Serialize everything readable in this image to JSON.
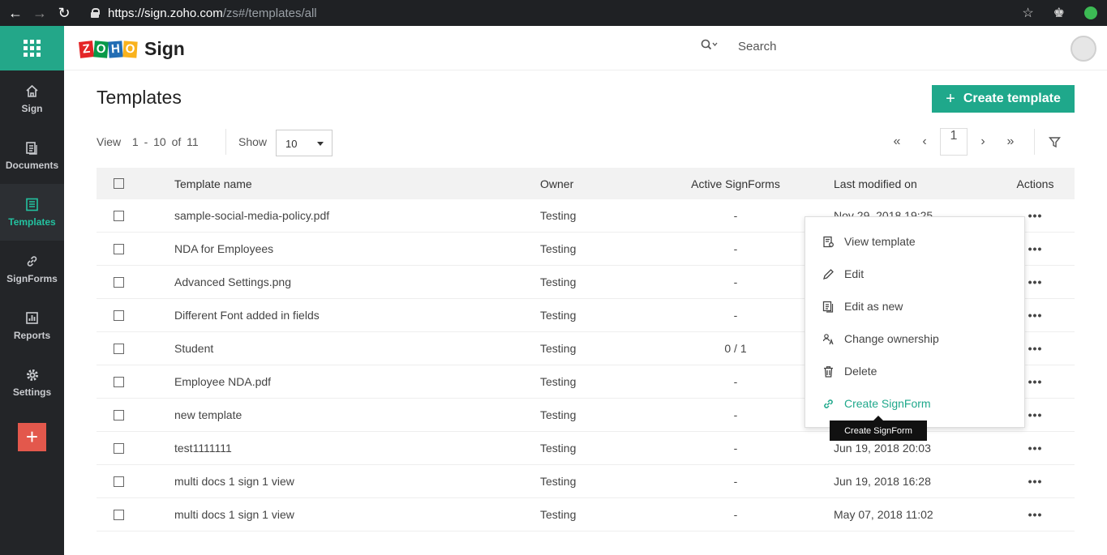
{
  "browser": {
    "url_host": "https://sign.zoho.com",
    "url_path": "/zs#/templates/all"
  },
  "brand": {
    "logo_letters": [
      "Z",
      "O",
      "H",
      "O"
    ],
    "logo_colors": [
      "#e42527",
      "#089949",
      "#226db4",
      "#f9b21d"
    ],
    "product": "Sign"
  },
  "search": {
    "placeholder": "Search"
  },
  "sidebar": {
    "items": [
      {
        "label": "Sign",
        "icon": "home-icon"
      },
      {
        "label": "Documents",
        "icon": "documents-icon"
      },
      {
        "label": "Templates",
        "icon": "templates-icon"
      },
      {
        "label": "SignForms",
        "icon": "link-icon"
      },
      {
        "label": "Reports",
        "icon": "reports-icon"
      },
      {
        "label": "Settings",
        "icon": "gear-icon"
      }
    ],
    "active": "Templates",
    "add_label": "+"
  },
  "page": {
    "title": "Templates",
    "create_label": "Create template",
    "view_label": "View",
    "range_start": "1",
    "range_sep": "-",
    "range_end": "10",
    "of_label": "of",
    "total": "11",
    "show_label": "Show",
    "show_value": "10",
    "page_number": "1"
  },
  "table": {
    "headers": [
      "Template name",
      "Owner",
      "Active SignForms",
      "Last modified on",
      "Actions"
    ],
    "rows": [
      {
        "name": "sample-social-media-policy.pdf",
        "owner": "Testing",
        "active": "-",
        "modified": "Nov 29, 2018 19:25"
      },
      {
        "name": "NDA for Employees",
        "owner": "Testing",
        "active": "-",
        "modified": ""
      },
      {
        "name": "Advanced Settings.png",
        "owner": "Testing",
        "active": "-",
        "modified": ""
      },
      {
        "name": "Different Font added in fields",
        "owner": "Testing",
        "active": "-",
        "modified": ""
      },
      {
        "name": "Student",
        "owner": "Testing",
        "active": "0 / 1",
        "modified": ""
      },
      {
        "name": "Employee NDA.pdf",
        "owner": "Testing",
        "active": "-",
        "modified": ""
      },
      {
        "name": "new template",
        "owner": "Testing",
        "active": "-",
        "modified": ""
      },
      {
        "name": "test1111111",
        "owner": "Testing",
        "active": "-",
        "modified": "Jun 19, 2018 20:03"
      },
      {
        "name": "multi docs 1 sign 1 view",
        "owner": "Testing",
        "active": "-",
        "modified": "Jun 19, 2018 16:28"
      },
      {
        "name": "multi docs 1 sign 1 view",
        "owner": "Testing",
        "active": "-",
        "modified": "May 07, 2018 11:02"
      }
    ],
    "actions_glyph": "•••"
  },
  "menu": {
    "items": [
      {
        "label": "View template",
        "icon": "view-template-icon"
      },
      {
        "label": "Edit",
        "icon": "pencil-icon"
      },
      {
        "label": "Edit as new",
        "icon": "copy-icon"
      },
      {
        "label": "Change ownership",
        "icon": "change-owner-icon"
      },
      {
        "label": "Delete",
        "icon": "trash-icon"
      },
      {
        "label": "Create SignForm",
        "icon": "link-icon"
      }
    ],
    "highlight_color": "#1fa88b"
  },
  "tooltip": {
    "text": "Create SignForm"
  },
  "colors": {
    "accent": "#1fa88b",
    "sidebar": "#232528",
    "add_button": "#e3584c"
  }
}
